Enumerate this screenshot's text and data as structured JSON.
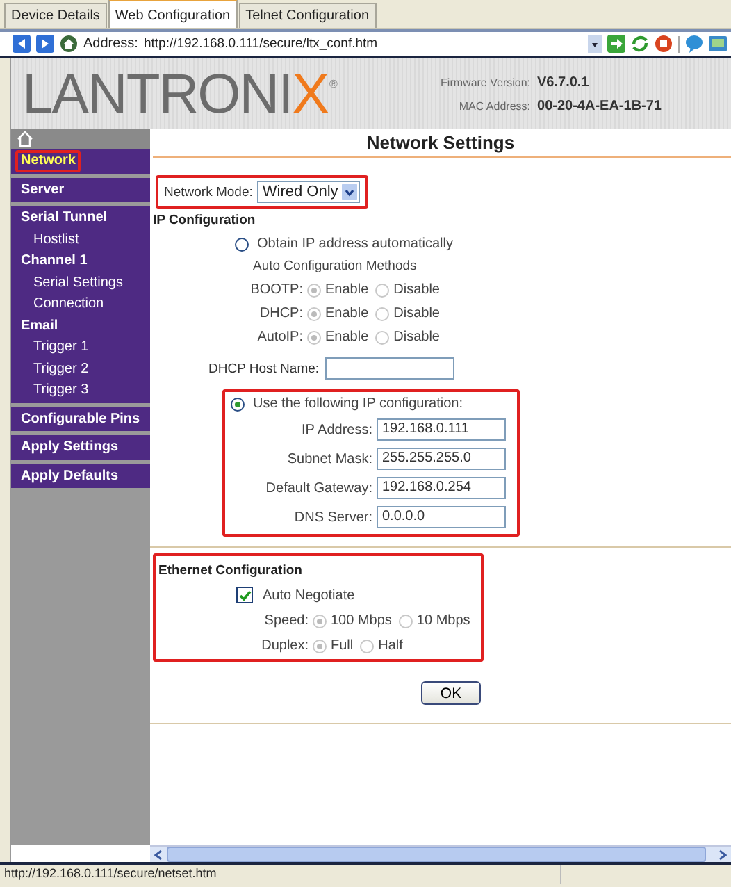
{
  "browser": {
    "tabs": [
      {
        "label": "Device Details",
        "selected": false
      },
      {
        "label": "Web Configuration",
        "selected": true
      },
      {
        "label": "Telnet Configuration",
        "selected": false
      }
    ],
    "address_label": "Address:",
    "url": "http://192.168.0.111/secure/ltx_conf.htm"
  },
  "header": {
    "logo": "LANTRONIX",
    "logo_mark": "®",
    "firmware_label": "Firmware Version:",
    "firmware": "V6.7.0.1",
    "mac_label": "MAC Address:",
    "mac": "00-20-4A-EA-1B-71"
  },
  "sidebar": {
    "groups": [
      {
        "items": [
          {
            "label": "Network",
            "selected": true,
            "highlighted": true
          }
        ]
      },
      {
        "items": [
          {
            "label": "Server",
            "selected": false,
            "highlighted": false
          }
        ]
      },
      {
        "items": [
          {
            "label": "Serial Tunnel",
            "selected": false,
            "highlighted": false,
            "children": [
              {
                "label": "Hostlist",
                "selected": false,
                "highlighted": false
              }
            ]
          },
          {
            "label": "Channel 1",
            "selected": false,
            "highlighted": false,
            "children": [
              {
                "label": "Serial Settings",
                "selected": false,
                "highlighted": false
              },
              {
                "label": "Connection",
                "selected": false,
                "highlighted": false
              }
            ]
          },
          {
            "label": "Email",
            "selected": false,
            "highlighted": false,
            "children": [
              {
                "label": "Trigger 1",
                "selected": false,
                "highlighted": false
              },
              {
                "label": "Trigger 2",
                "selected": false,
                "highlighted": false
              },
              {
                "label": "Trigger 3",
                "selected": false,
                "highlighted": false
              }
            ]
          }
        ]
      },
      {
        "items": [
          {
            "label": "Configurable Pins",
            "selected": false,
            "highlighted": false
          }
        ]
      },
      {
        "items": [
          {
            "label": "Apply Settings",
            "selected": false,
            "highlighted": false
          }
        ]
      },
      {
        "items": [
          {
            "label": "Apply Defaults",
            "selected": false,
            "highlighted": false
          }
        ]
      }
    ]
  },
  "page": {
    "title": "Network Settings",
    "network_mode": {
      "label": "Network Mode:",
      "value": "Wired Only",
      "highlighted": true
    },
    "ip_configuration": {
      "title": "IP Configuration",
      "auto": {
        "label": "Obtain IP address automatically",
        "selected": false,
        "methods_label": "Auto Configuration Methods",
        "methods": [
          {
            "label": "BOOTP:",
            "disabled": true,
            "choices": [
              {
                "label": "Enable",
                "selected": true
              },
              {
                "label": "Disable",
                "selected": false
              }
            ]
          },
          {
            "label": "DHCP:",
            "disabled": true,
            "choices": [
              {
                "label": "Enable",
                "selected": true
              },
              {
                "label": "Disable",
                "selected": false
              }
            ]
          },
          {
            "label": "AutoIP:",
            "disabled": true,
            "choices": [
              {
                "label": "Enable",
                "selected": true
              },
              {
                "label": "Disable",
                "selected": false
              }
            ]
          }
        ],
        "host_name_label": "DHCP Host Name:"
      },
      "static": {
        "label": "Use the following IP configuration:",
        "selected": true,
        "highlighted": true,
        "fields": [
          {
            "label": "IP Address:",
            "value": "192.168.0.111"
          },
          {
            "label": "Subnet Mask:",
            "value": "255.255.255.0"
          },
          {
            "label": "Default Gateway:",
            "value": "192.168.0.254"
          },
          {
            "label": "DNS Server:",
            "value": "0.0.0.0"
          }
        ]
      }
    },
    "ethernet": {
      "title": "Ethernet Configuration",
      "highlighted": true,
      "auto_negotiate": {
        "label": "Auto Negotiate",
        "checked": true
      },
      "settings": [
        {
          "label": "Speed:",
          "disabled": true,
          "choices": [
            {
              "label": "100 Mbps",
              "selected": true
            },
            {
              "label": "10 Mbps",
              "selected": false
            }
          ]
        },
        {
          "label": "Duplex:",
          "disabled": true,
          "choices": [
            {
              "label": "Full",
              "selected": true
            },
            {
              "label": "Half",
              "selected": false
            }
          ]
        }
      ]
    },
    "ok_button": "OK"
  },
  "status_bar": {
    "url": "http://192.168.0.111/secure/netset.htm"
  }
}
